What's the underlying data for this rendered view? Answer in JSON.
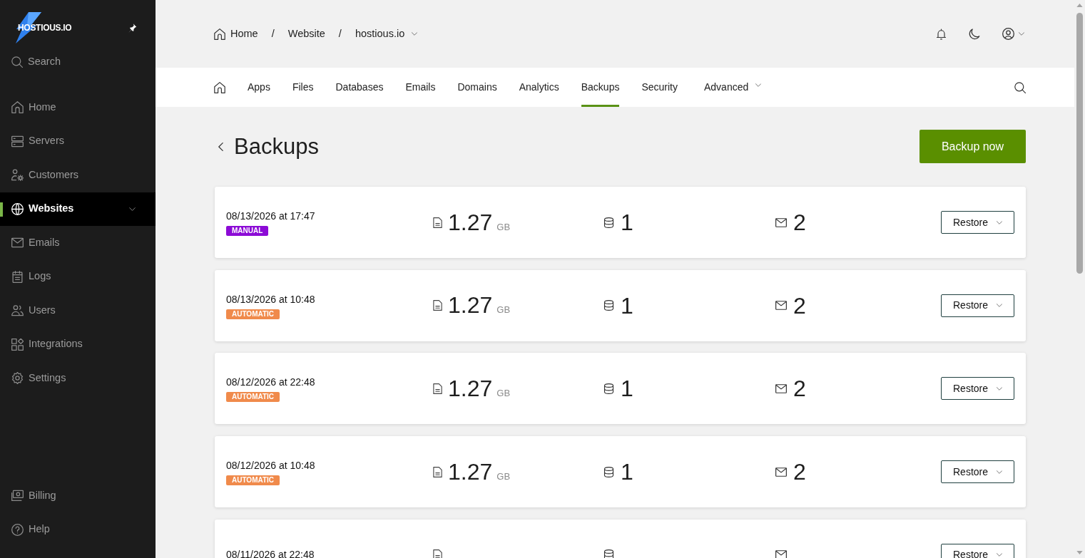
{
  "sidebar": {
    "logo": "HOSTIOUS.IO",
    "search_label": "Search",
    "items": [
      {
        "label": "Home",
        "selected": false,
        "expandable": false
      },
      {
        "label": "Servers",
        "selected": false,
        "expandable": false
      },
      {
        "label": "Customers",
        "selected": false,
        "expandable": false
      },
      {
        "label": "Websites",
        "selected": true,
        "expandable": true
      },
      {
        "label": "Emails",
        "selected": false,
        "expandable": false
      },
      {
        "label": "Logs",
        "selected": false,
        "expandable": false
      },
      {
        "label": "Users",
        "selected": false,
        "expandable": false
      },
      {
        "label": "Integrations",
        "selected": false,
        "expandable": false
      },
      {
        "label": "Settings",
        "selected": false,
        "expandable": false
      }
    ],
    "footer_items": [
      {
        "label": "Billing"
      },
      {
        "label": "Help"
      }
    ]
  },
  "breadcrumb": [
    {
      "kind": "home",
      "label": "Home"
    },
    {
      "kind": "separator",
      "label": "/"
    },
    {
      "kind": "link",
      "label": "Website"
    },
    {
      "kind": "separator",
      "label": "/"
    },
    {
      "kind": "dropdown",
      "label": "hostious.io"
    }
  ],
  "tabs": [
    {
      "kind": "home",
      "selected": false
    },
    {
      "kind": "text",
      "label": "Apps",
      "selected": false
    },
    {
      "kind": "text",
      "label": "Files",
      "selected": false
    },
    {
      "kind": "text",
      "label": "Databases",
      "selected": false
    },
    {
      "kind": "text",
      "label": "Emails",
      "selected": false
    },
    {
      "kind": "text",
      "label": "Domains",
      "selected": false
    },
    {
      "kind": "text",
      "label": "Analytics",
      "selected": false
    },
    {
      "kind": "text",
      "label": "Backups",
      "selected": true
    },
    {
      "kind": "text",
      "label": "Security",
      "selected": false
    },
    {
      "kind": "dropdown",
      "label": "Advanced",
      "selected": false
    }
  ],
  "page": {
    "title": "Backups",
    "action": "Backup now"
  },
  "backups": [
    {
      "date": "08/13/2026 at 17:47",
      "badge": {
        "text": "MANUAL",
        "color": "#8c0bd6"
      },
      "size": "1.27",
      "unit": "GB",
      "databases": "1",
      "emails": "2",
      "action": "Restore"
    },
    {
      "date": "08/13/2026 at 10:48",
      "badge": {
        "text": "AUTOMATIC",
        "color": "#f08a4b"
      },
      "size": "1.27",
      "unit": "GB",
      "databases": "1",
      "emails": "2",
      "action": "Restore"
    },
    {
      "date": "08/12/2026 at 22:48",
      "badge": {
        "text": "AUTOMATIC",
        "color": "#f08a4b"
      },
      "size": "1.27",
      "unit": "GB",
      "databases": "1",
      "emails": "2",
      "action": "Restore"
    },
    {
      "date": "08/12/2026 at 10:48",
      "badge": {
        "text": "AUTOMATIC",
        "color": "#f08a4b"
      },
      "size": "1.27",
      "unit": "GB",
      "databases": "1",
      "emails": "2",
      "action": "Restore"
    },
    {
      "date": "08/11/2026 at 22:48",
      "action": "Restore"
    }
  ]
}
